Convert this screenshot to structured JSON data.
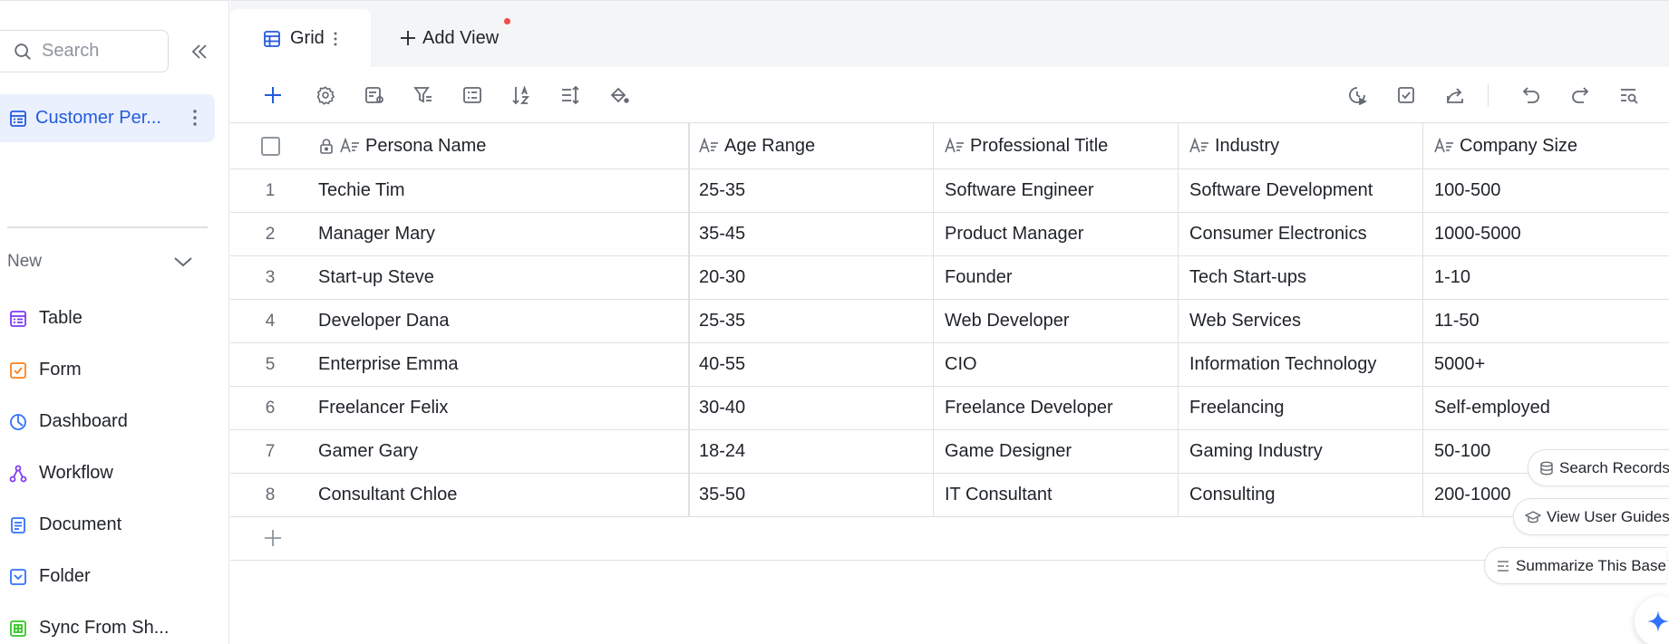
{
  "sidebar": {
    "search_placeholder": "Search",
    "base_name": "Customer Per...",
    "new_label": "New",
    "menu": [
      {
        "label": "Table",
        "icon": "table-icon",
        "color": "#7f3bf5"
      },
      {
        "label": "Form",
        "icon": "form-icon",
        "color": "#ff811a"
      },
      {
        "label": "Dashboard",
        "icon": "dashboard-icon",
        "color": "#3370ff"
      },
      {
        "label": "Workflow",
        "icon": "workflow-icon",
        "color": "#7f3bf5"
      },
      {
        "label": "Document",
        "icon": "document-icon",
        "color": "#3370ff"
      },
      {
        "label": "Folder",
        "icon": "folder-icon",
        "color": "#3370ff"
      },
      {
        "label": "Sync From Sh...",
        "icon": "sync-sheet-icon",
        "color": "#34c724"
      }
    ]
  },
  "tabs": {
    "grid_label": "Grid",
    "add_view_label": "Add View"
  },
  "grid": {
    "columns": [
      "Persona Name",
      "Age Range",
      "Professional Title",
      "Industry",
      "Company Size"
    ],
    "rows": [
      {
        "num": "1",
        "cells": [
          "Techie Tim",
          "25-35",
          "Software Engineer",
          "Software Development",
          "100-500"
        ]
      },
      {
        "num": "2",
        "cells": [
          "Manager Mary",
          "35-45",
          "Product Manager",
          "Consumer Electronics",
          "1000-5000"
        ]
      },
      {
        "num": "3",
        "cells": [
          "Start-up Steve",
          "20-30",
          "Founder",
          "Tech Start-ups",
          "1-10"
        ]
      },
      {
        "num": "4",
        "cells": [
          "Developer Dana",
          "25-35",
          "Web Developer",
          "Web Services",
          "11-50"
        ]
      },
      {
        "num": "5",
        "cells": [
          "Enterprise Emma",
          "40-55",
          "CIO",
          "Information Technology",
          "5000+"
        ]
      },
      {
        "num": "6",
        "cells": [
          "Freelancer Felix",
          "30-40",
          "Freelance Developer",
          "Freelancing",
          "Self-employed"
        ]
      },
      {
        "num": "7",
        "cells": [
          "Gamer Gary",
          "18-24",
          "Game Designer",
          "Gaming Industry",
          "50-100"
        ]
      },
      {
        "num": "8",
        "cells": [
          "Consultant Chloe",
          "35-50",
          "IT Consultant",
          "Consulting",
          "200-1000"
        ]
      }
    ]
  },
  "floating": {
    "search_records": "Search Records",
    "view_user_guides": "View User Guides",
    "summarize_base": "Summarize This Base"
  },
  "colors": {
    "accent": "#245bdb",
    "selected_bg": "#eaf0fd",
    "notification_dot": "#f54a45"
  }
}
